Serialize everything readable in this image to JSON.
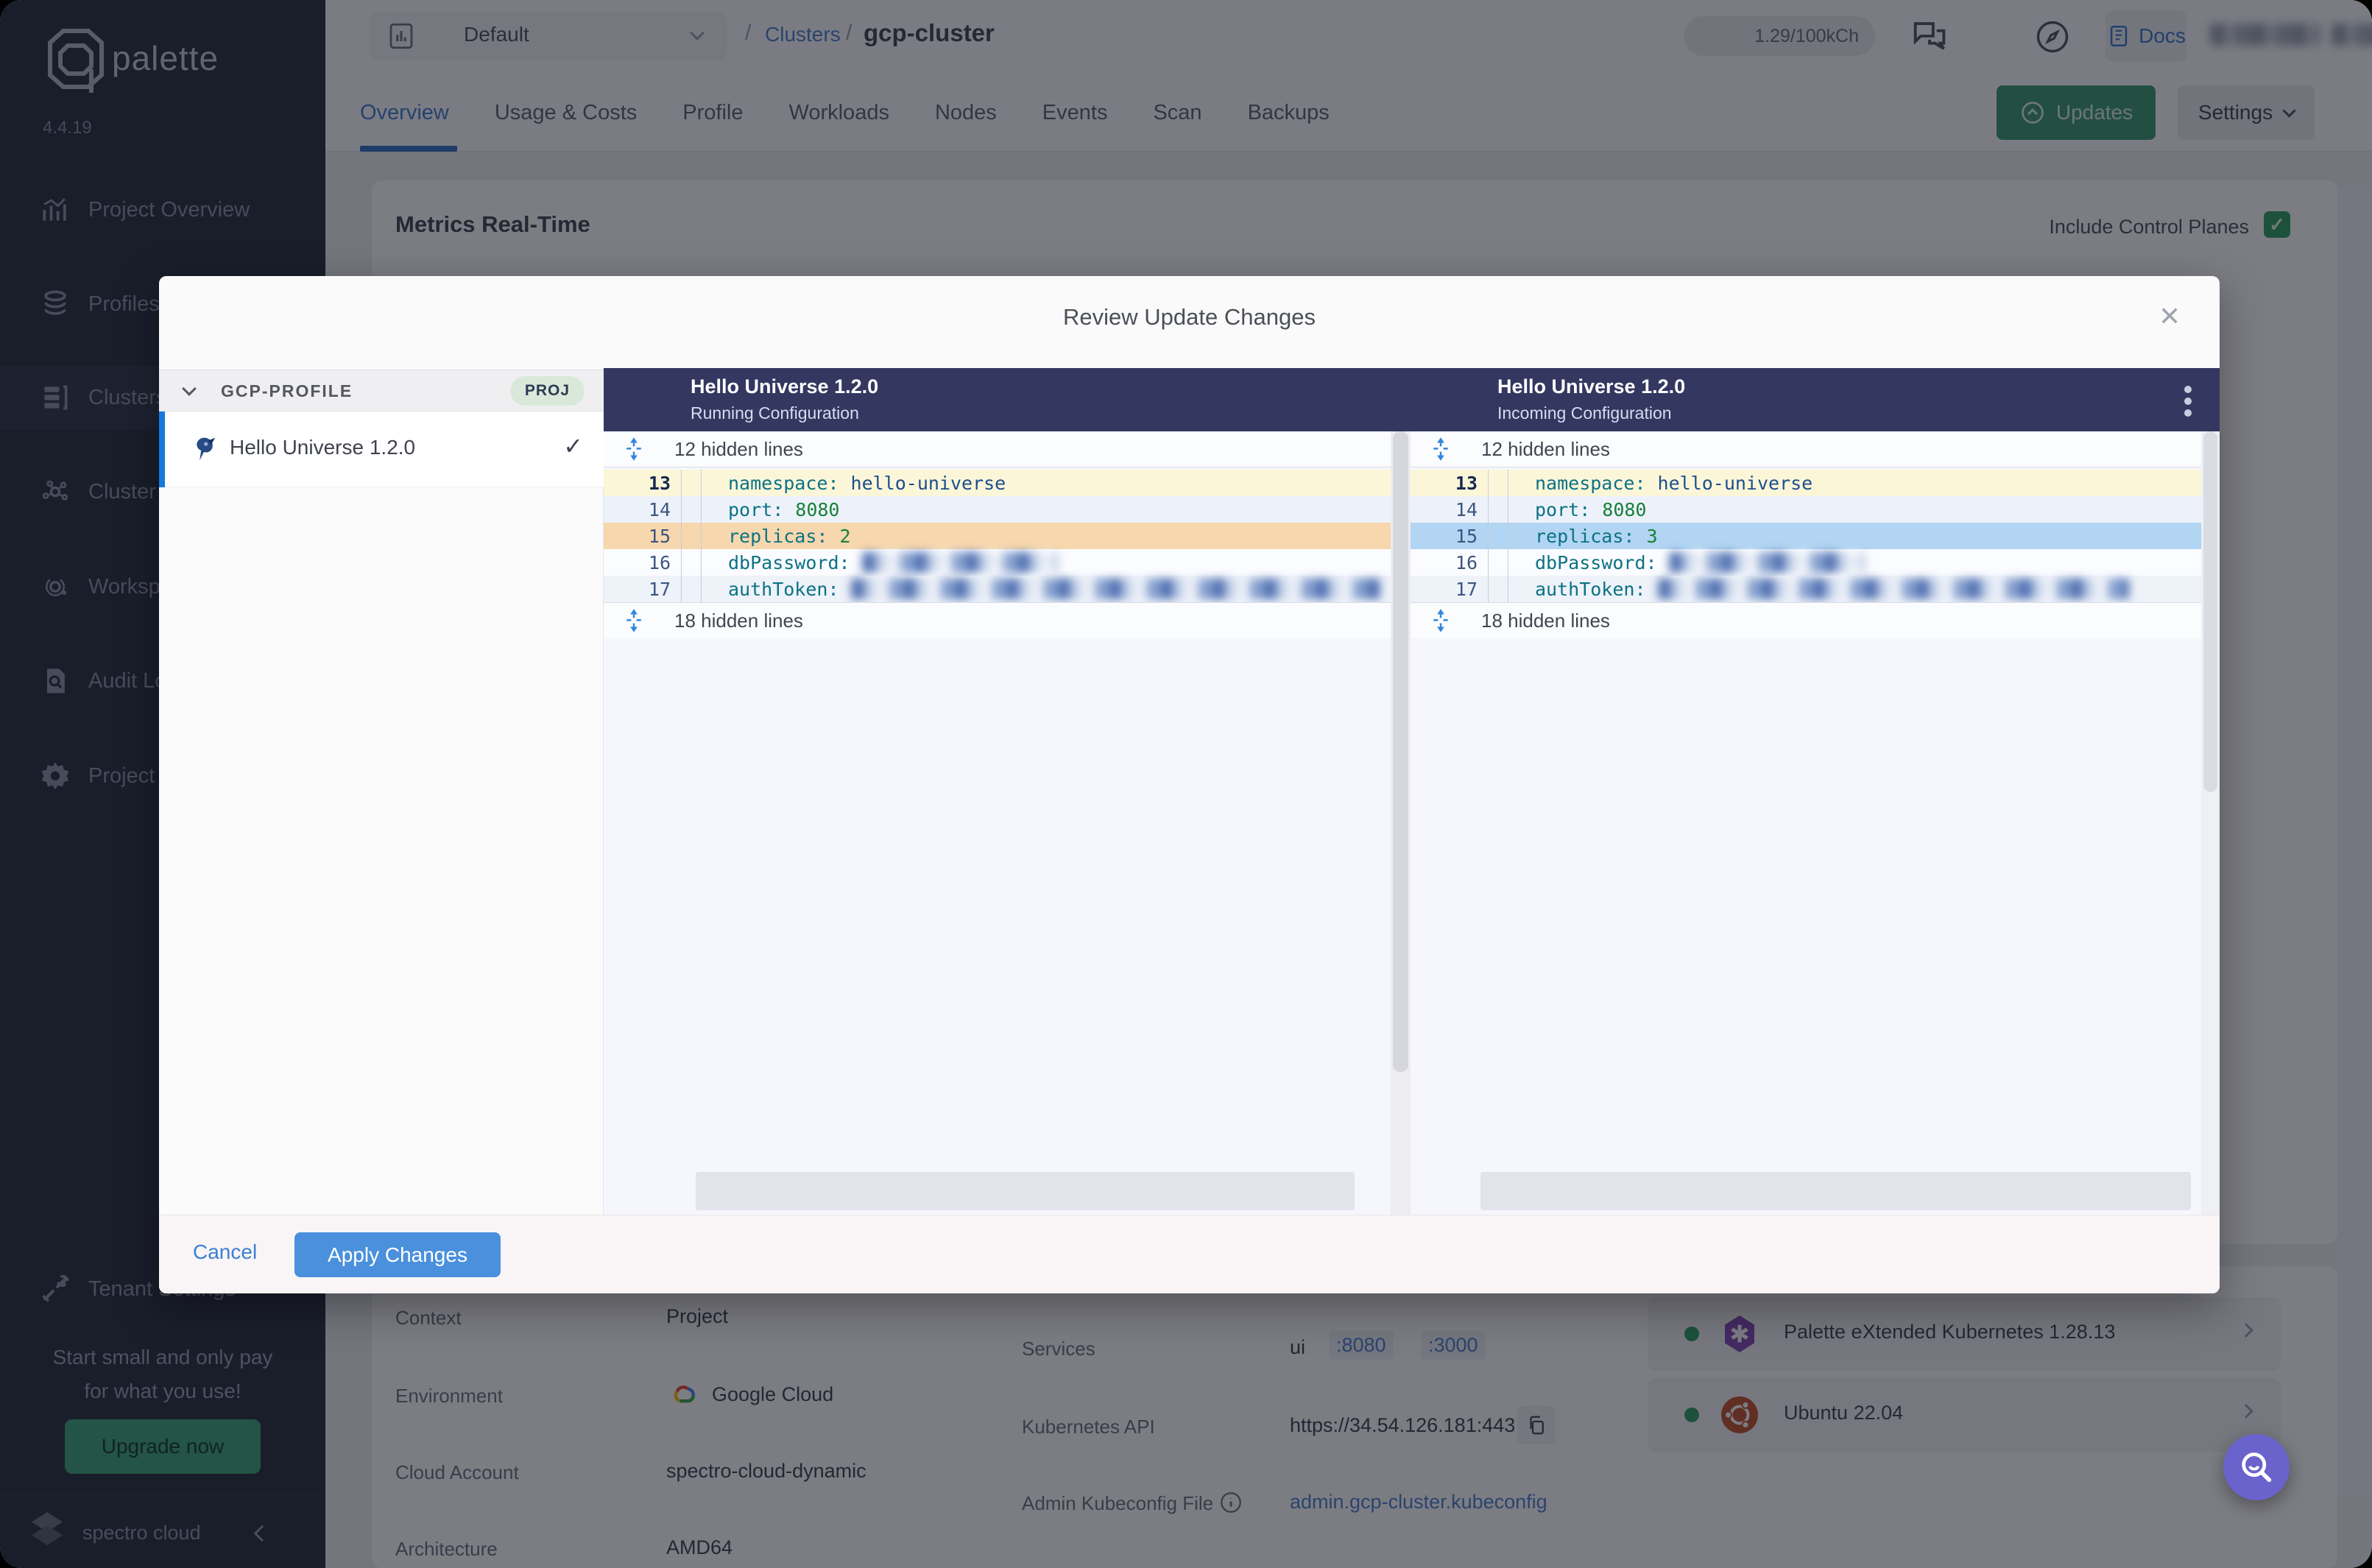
{
  "colors": {
    "sidebar_bg": "#262d3d",
    "accent_blue": "#4a90dc",
    "tab_active": "#3e7cd1",
    "updates_green": "#3a9a72",
    "checkbox_green": "#2f9e63",
    "fab_purple": "#6a63cc",
    "diff_header_bg": "#343760",
    "diff_removed_bg": "#f7d7ad",
    "diff_added_bg": "#b1d5f2",
    "diff_context_yellow": "#fcf6d9",
    "key_teal": "#0b7285",
    "string_navy": "#1a4f8a",
    "number_green": "#188038"
  },
  "sidebar": {
    "brand": "palette",
    "version": "4.4.19",
    "items": [
      {
        "label": "Project Overview"
      },
      {
        "label": "Profiles"
      },
      {
        "label": "Clusters"
      },
      {
        "label": "Cluster Groups"
      },
      {
        "label": "Workspaces"
      },
      {
        "label": "Audit Logs"
      },
      {
        "label": "Project Settings"
      },
      {
        "label": "Tenant Settings"
      }
    ],
    "promo_line1": "Start small and only pay",
    "promo_line2": "for what you use!",
    "upgrade": "Upgrade now",
    "footer_brand": "spectro cloud"
  },
  "topbar": {
    "project_selector": "Default",
    "sep1": "/",
    "breadcrumb_section": "Clusters",
    "sep2": "/",
    "breadcrumb_current": "gcp-cluster",
    "usage": "1.29/100kCh",
    "docs": "Docs"
  },
  "tabs": {
    "items": [
      {
        "label": "Overview"
      },
      {
        "label": "Usage & Costs"
      },
      {
        "label": "Profile"
      },
      {
        "label": "Workloads"
      },
      {
        "label": "Nodes"
      },
      {
        "label": "Events"
      },
      {
        "label": "Scan"
      },
      {
        "label": "Backups"
      }
    ]
  },
  "actions": {
    "updates": "Updates",
    "settings": "Settings"
  },
  "metrics": {
    "title": "Metrics Real-Time",
    "control_planes": "Include Control Planes",
    "check": "✓"
  },
  "modal": {
    "title": "Review Update Changes",
    "close": "✕",
    "group": {
      "name": "GCP-PROFILE",
      "badge": "PROJ"
    },
    "profile": {
      "name": "Hello Universe 1.2.0",
      "check": "✓"
    },
    "left_pane": {
      "title": "Hello Universe 1.2.0",
      "subtitle": "Running Configuration",
      "hidden_top": "12 hidden lines",
      "hidden_bottom": "18 hidden lines",
      "lines": [
        {
          "no": "13",
          "key": "namespace:",
          "value": "hello-universe"
        },
        {
          "no": "14",
          "key": "port:",
          "value": "8080"
        },
        {
          "no": "15",
          "key": "replicas:",
          "value": "2"
        },
        {
          "no": "16",
          "key": "dbPassword:",
          "redacted": true
        },
        {
          "no": "17",
          "key": "authToken:",
          "redacted": true
        }
      ]
    },
    "right_pane": {
      "title": "Hello Universe 1.2.0",
      "subtitle": "Incoming Configuration",
      "hidden_top": "12 hidden lines",
      "hidden_bottom": "18 hidden lines",
      "lines": [
        {
          "no": "13",
          "key": "namespace:",
          "value": "hello-universe"
        },
        {
          "no": "14",
          "key": "port:",
          "value": "8080"
        },
        {
          "no": "15",
          "key": "replicas:",
          "value": "3"
        },
        {
          "no": "16",
          "key": "dbPassword:",
          "redacted": true
        },
        {
          "no": "17",
          "key": "authToken:",
          "redacted": true
        }
      ]
    },
    "footer": {
      "cancel": "Cancel",
      "apply": "Apply Changes"
    }
  },
  "details": {
    "rows": [
      {
        "label": "Context",
        "value": "Project"
      },
      {
        "label": "Environment",
        "value": "Google Cloud"
      },
      {
        "label": "Cloud Account",
        "value": "spectro-cloud-dynamic"
      },
      {
        "label": "Architecture",
        "value": "AMD64"
      }
    ],
    "services": {
      "label": "Services",
      "name": "ui",
      "port1": ":8080",
      "port2": ":3000"
    },
    "api": {
      "label": "Kubernetes API",
      "value": "https://34.54.126.181:443"
    },
    "kubeconfig": {
      "label": "Admin Kubeconfig File",
      "value": "admin.gcp-cluster.kubeconfig"
    }
  },
  "packs": [
    {
      "name": "Palette eXtended Kubernetes 1.28.13"
    },
    {
      "name": "Ubuntu 22.04"
    }
  ]
}
